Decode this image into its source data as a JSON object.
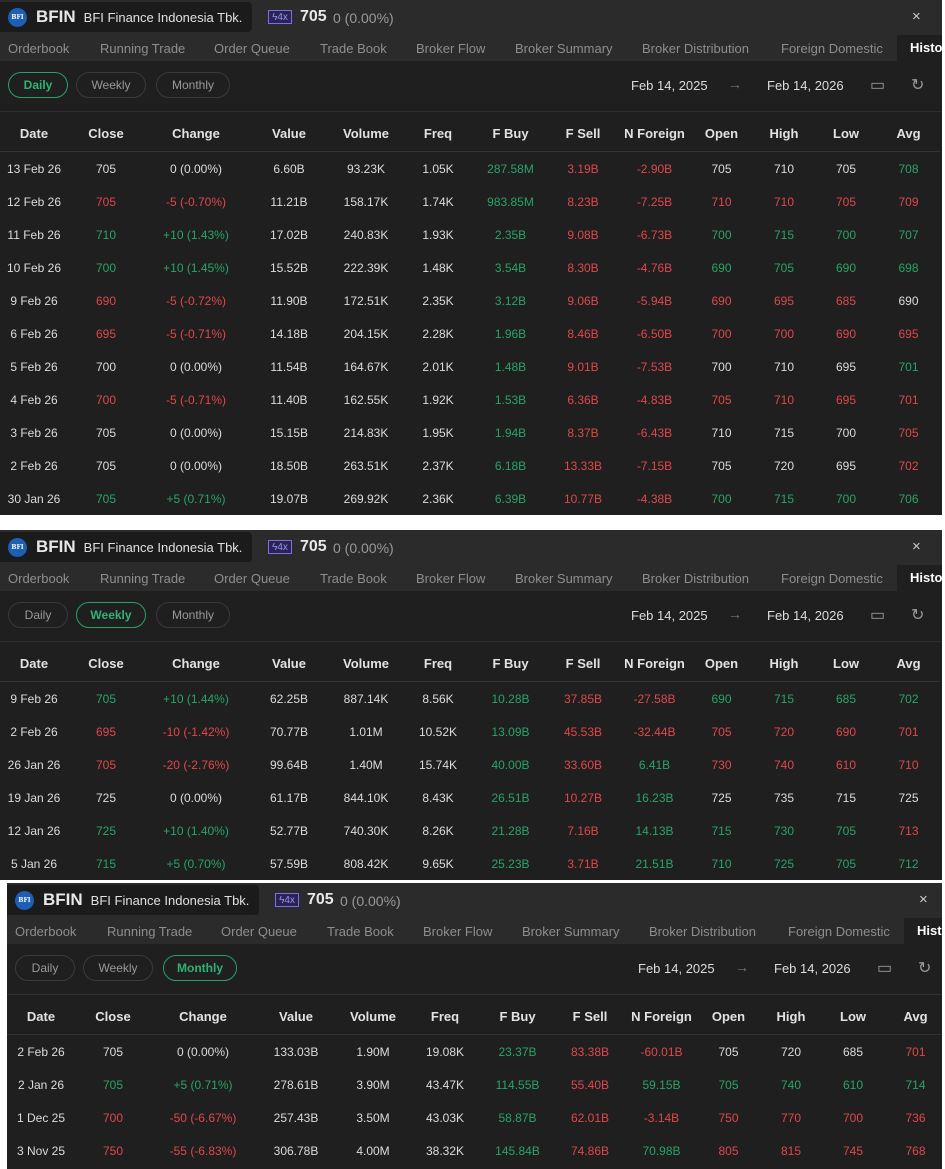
{
  "colors": {
    "green": "#28a468",
    "red": "#e0474c",
    "accent": "#27a06a"
  },
  "panels": [
    {
      "ticker": "BFIN",
      "company": "BFI Finance Indonesia Tbk.",
      "badge": "4x",
      "price": "705",
      "change": "0 (0.00%)",
      "close_icon": "×",
      "tabs": [
        "Orderbook",
        "Running Trade",
        "Order Queue",
        "Trade Book",
        "Broker Flow",
        "Broker Summary",
        "Broker Distribution",
        "Foreign Domestic",
        "Histo"
      ],
      "periods": [
        "Daily",
        "Weekly",
        "Monthly"
      ],
      "active_period": "Daily",
      "date_from": "Feb 14, 2025",
      "date_arrow": "→",
      "date_to": "Feb 14, 2026",
      "columns": [
        "Date",
        "Close",
        "Change",
        "Value",
        "Volume",
        "Freq",
        "F Buy",
        "F Sell",
        "N Foreign",
        "Open",
        "High",
        "Low",
        "Avg"
      ],
      "rows": [
        {
          "c": [
            "13 Feb 26",
            "705",
            "0 (0.00%)",
            "6.60B",
            "93.23K",
            "1.05K",
            "287.58M",
            "3.19B",
            "-2.90B",
            "705",
            "710",
            "705",
            "708"
          ],
          "k": "wwwwwwgrrwwwg"
        },
        {
          "c": [
            "12 Feb 26",
            "705",
            "-5 (-0.70%)",
            "11.21B",
            "158.17K",
            "1.74K",
            "983.85M",
            "8.23B",
            "-7.25B",
            "710",
            "710",
            "705",
            "709"
          ],
          "k": "wrrwwwgrrrrrr"
        },
        {
          "c": [
            "11 Feb 26",
            "710",
            "+10 (1.43%)",
            "17.02B",
            "240.83K",
            "1.93K",
            "2.35B",
            "9.08B",
            "-6.73B",
            "700",
            "715",
            "700",
            "707"
          ],
          "k": "wggwwwgrrgggg"
        },
        {
          "c": [
            "10 Feb 26",
            "700",
            "+10 (1.45%)",
            "15.52B",
            "222.39K",
            "1.48K",
            "3.54B",
            "8.30B",
            "-4.76B",
            "690",
            "705",
            "690",
            "698"
          ],
          "k": "wggwwwgrrgggg"
        },
        {
          "c": [
            "9 Feb 26",
            "690",
            "-5 (-0.72%)",
            "11.90B",
            "172.51K",
            "2.35K",
            "3.12B",
            "9.06B",
            "-5.94B",
            "690",
            "695",
            "685",
            "690"
          ],
          "k": "wrrwwwgrrrrrw"
        },
        {
          "c": [
            "6 Feb 26",
            "695",
            "-5 (-0.71%)",
            "14.18B",
            "204.15K",
            "2.28K",
            "1.96B",
            "8.46B",
            "-6.50B",
            "700",
            "700",
            "690",
            "695"
          ],
          "k": "wrrwwwgrrrrrr"
        },
        {
          "c": [
            "5 Feb 26",
            "700",
            "0 (0.00%)",
            "11.54B",
            "164.67K",
            "2.01K",
            "1.48B",
            "9.01B",
            "-7.53B",
            "700",
            "710",
            "695",
            "701"
          ],
          "k": "wwwwwwgrrwwwg"
        },
        {
          "c": [
            "4 Feb 26",
            "700",
            "-5 (-0.71%)",
            "11.40B",
            "162.55K",
            "1.92K",
            "1.53B",
            "6.36B",
            "-4.83B",
            "705",
            "710",
            "695",
            "701"
          ],
          "k": "wrrwwwgrrrrrr"
        },
        {
          "c": [
            "3 Feb 26",
            "705",
            "0 (0.00%)",
            "15.15B",
            "214.83K",
            "1.95K",
            "1.94B",
            "8.37B",
            "-6.43B",
            "710",
            "715",
            "700",
            "705"
          ],
          "k": "wwwwwwgrrwwwr"
        },
        {
          "c": [
            "2 Feb 26",
            "705",
            "0 (0.00%)",
            "18.50B",
            "263.51K",
            "2.37K",
            "6.18B",
            "13.33B",
            "-7.15B",
            "705",
            "720",
            "695",
            "702"
          ],
          "k": "wwwwwwgrrwwwr"
        },
        {
          "c": [
            "30 Jan 26",
            "705",
            "+5 (0.71%)",
            "19.07B",
            "269.92K",
            "2.36K",
            "6.39B",
            "10.77B",
            "-4.38B",
            "700",
            "715",
            "700",
            "706"
          ],
          "k": "wggwwwgrrgggg"
        }
      ]
    },
    {
      "ticker": "BFIN",
      "company": "BFI Finance Indonesia Tbk.",
      "badge": "4x",
      "price": "705",
      "change": "0 (0.00%)",
      "close_icon": "×",
      "tabs": [
        "Orderbook",
        "Running Trade",
        "Order Queue",
        "Trade Book",
        "Broker Flow",
        "Broker Summary",
        "Broker Distribution",
        "Foreign Domestic",
        "Histo"
      ],
      "periods": [
        "Daily",
        "Weekly",
        "Monthly"
      ],
      "active_period": "Weekly",
      "date_from": "Feb 14, 2025",
      "date_arrow": "→",
      "date_to": "Feb 14, 2026",
      "columns": [
        "Date",
        "Close",
        "Change",
        "Value",
        "Volume",
        "Freq",
        "F Buy",
        "F Sell",
        "N Foreign",
        "Open",
        "High",
        "Low",
        "Avg"
      ],
      "rows": [
        {
          "c": [
            "9 Feb 26",
            "705",
            "+10 (1.44%)",
            "62.25B",
            "887.14K",
            "8.56K",
            "10.28B",
            "37.85B",
            "-27.58B",
            "690",
            "715",
            "685",
            "702"
          ],
          "k": "wggwwwgrrgggg"
        },
        {
          "c": [
            "2 Feb 26",
            "695",
            "-10 (-1.42%)",
            "70.77B",
            "1.01M",
            "10.52K",
            "13.09B",
            "45.53B",
            "-32.44B",
            "705",
            "720",
            "690",
            "701"
          ],
          "k": "wrrwwwgrrrrrr"
        },
        {
          "c": [
            "26 Jan 26",
            "705",
            "-20 (-2.76%)",
            "99.64B",
            "1.40M",
            "15.74K",
            "40.00B",
            "33.60B",
            "6.41B",
            "730",
            "740",
            "610",
            "710"
          ],
          "k": "wrrwwwgrgrrrr"
        },
        {
          "c": [
            "19 Jan 26",
            "725",
            "0 (0.00%)",
            "61.17B",
            "844.10K",
            "8.43K",
            "26.51B",
            "10.27B",
            "16.23B",
            "725",
            "735",
            "715",
            "725"
          ],
          "k": "wwwwwwgrgwwww"
        },
        {
          "c": [
            "12 Jan 26",
            "725",
            "+10 (1.40%)",
            "52.77B",
            "740.30K",
            "8.26K",
            "21.28B",
            "7.16B",
            "14.13B",
            "715",
            "730",
            "705",
            "713"
          ],
          "k": "wggwwwgrggggr"
        },
        {
          "c": [
            "5 Jan 26",
            "715",
            "+5 (0.70%)",
            "57.59B",
            "808.42K",
            "9.65K",
            "25.23B",
            "3.71B",
            "21.51B",
            "710",
            "725",
            "705",
            "712"
          ],
          "k": "wggwwwgrggggg"
        }
      ]
    },
    {
      "ticker": "BFIN",
      "company": "BFI Finance Indonesia Tbk.",
      "badge": "4x",
      "price": "705",
      "change": "0 (0.00%)",
      "close_icon": "×",
      "tabs": [
        "Orderbook",
        "Running Trade",
        "Order Queue",
        "Trade Book",
        "Broker Flow",
        "Broker Summary",
        "Broker Distribution",
        "Foreign Domestic",
        "Histo"
      ],
      "periods": [
        "Daily",
        "Weekly",
        "Monthly"
      ],
      "active_period": "Monthly",
      "date_from": "Feb 14, 2025",
      "date_arrow": "→",
      "date_to": "Feb 14, 2026",
      "columns": [
        "Date",
        "Close",
        "Change",
        "Value",
        "Volume",
        "Freq",
        "F Buy",
        "F Sell",
        "N Foreign",
        "Open",
        "High",
        "Low",
        "Avg"
      ],
      "rows": [
        {
          "c": [
            "2 Feb 26",
            "705",
            "0 (0.00%)",
            "133.03B",
            "1.90M",
            "19.08K",
            "23.37B",
            "83.38B",
            "-60.01B",
            "705",
            "720",
            "685",
            "701"
          ],
          "k": "wwwwwwgrrwwwr"
        },
        {
          "c": [
            "2 Jan 26",
            "705",
            "+5 (0.71%)",
            "278.61B",
            "3.90M",
            "43.47K",
            "114.55B",
            "55.40B",
            "59.15B",
            "705",
            "740",
            "610",
            "714"
          ],
          "k": "wggwwwgrggggg"
        },
        {
          "c": [
            "1 Dec 25",
            "700",
            "-50 (-6.67%)",
            "257.43B",
            "3.50M",
            "43.03K",
            "58.87B",
            "62.01B",
            "-3.14B",
            "750",
            "770",
            "700",
            "736"
          ],
          "k": "wrrwwwgrrrrrr"
        },
        {
          "c": [
            "3 Nov 25",
            "750",
            "-55 (-6.83%)",
            "306.78B",
            "4.00M",
            "38.32K",
            "145.84B",
            "74.86B",
            "70.98B",
            "805",
            "815",
            "745",
            "768"
          ],
          "k": "wrrwwwgrgrrrr"
        }
      ]
    }
  ]
}
